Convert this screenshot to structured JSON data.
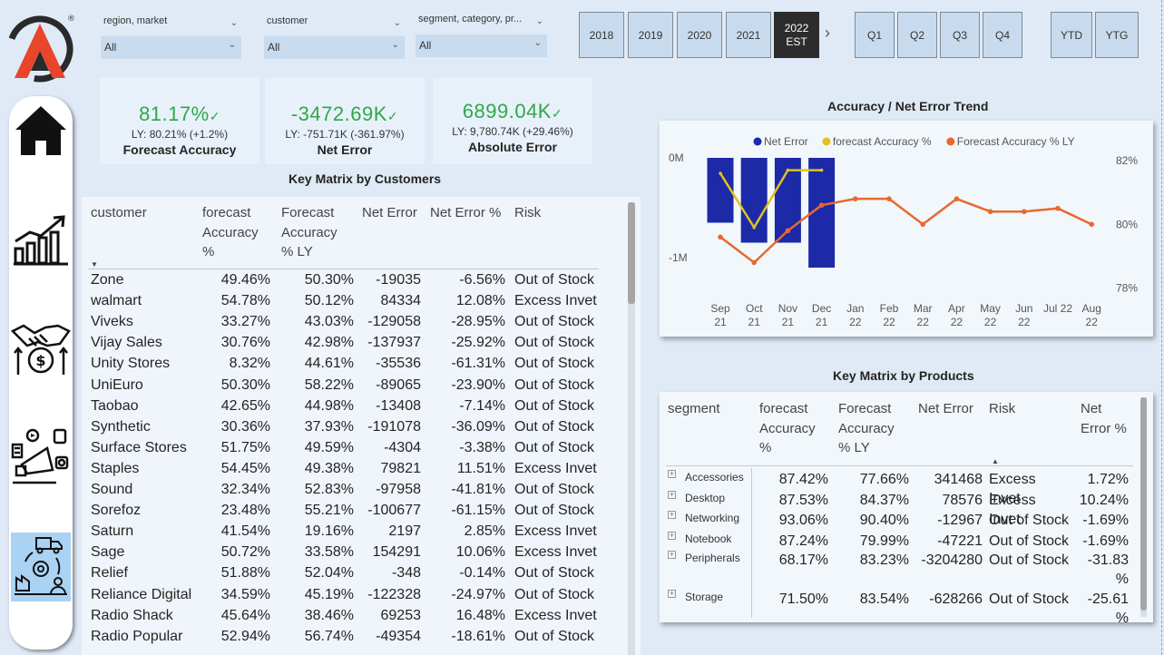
{
  "filters": [
    {
      "title": "region, market",
      "value": "All"
    },
    {
      "title": "customer",
      "value": "All"
    },
    {
      "title": "segment, category, pr...",
      "value": "All"
    }
  ],
  "years": [
    {
      "label": "2018",
      "active": false
    },
    {
      "label": "2019",
      "active": false
    },
    {
      "label": "2020",
      "active": false
    },
    {
      "label": "2021",
      "active": false
    },
    {
      "label": "2022\nEST",
      "active": true
    }
  ],
  "quarters": [
    "Q1",
    "Q2",
    "Q3",
    "Q4"
  ],
  "periods": [
    "YTD",
    "YTG"
  ],
  "kpis": [
    {
      "value": "81.17%",
      "ly": "LY: 80.21% (+1.2%)",
      "label": "Forecast Accuracy"
    },
    {
      "value": "-3472.69K",
      "ly": "LY: -751.71K (-361.97%)",
      "label": "Net Error"
    },
    {
      "value": "6899.04K",
      "ly": "LY: 9,780.74K (+29.46%)",
      "label": "Absolute Error"
    }
  ],
  "customers_table": {
    "title": "Key Matrix by Customers",
    "headers": [
      "customer",
      "forecast\nAccuracy\n%",
      "Forecast\nAccuracy\n% LY",
      "Net Error",
      "Net Error %",
      "Risk"
    ],
    "rows": [
      [
        "Zone",
        "49.46%",
        "50.30%",
        "-19035",
        "-6.56%",
        "Out of Stock"
      ],
      [
        "walmart",
        "54.78%",
        "50.12%",
        "84334",
        "12.08%",
        "Excess Invet"
      ],
      [
        "Viveks",
        "33.27%",
        "43.03%",
        "-129058",
        "-28.95%",
        "Out of Stock"
      ],
      [
        "Vijay Sales",
        "30.76%",
        "42.98%",
        "-137937",
        "-25.92%",
        "Out of Stock"
      ],
      [
        "Unity Stores",
        "8.32%",
        "44.61%",
        "-35536",
        "-61.31%",
        "Out of Stock"
      ],
      [
        "UniEuro",
        "50.30%",
        "58.22%",
        "-89065",
        "-23.90%",
        "Out of Stock"
      ],
      [
        "Taobao",
        "42.65%",
        "44.98%",
        "-13408",
        "-7.14%",
        "Out of Stock"
      ],
      [
        "Synthetic",
        "30.36%",
        "37.93%",
        "-191078",
        "-36.09%",
        "Out of Stock"
      ],
      [
        "Surface Stores",
        "51.75%",
        "49.59%",
        "-4304",
        "-3.38%",
        "Out of Stock"
      ],
      [
        "Staples",
        "54.45%",
        "49.38%",
        "79821",
        "11.51%",
        "Excess Invet"
      ],
      [
        "Sound",
        "32.34%",
        "52.83%",
        "-97958",
        "-41.81%",
        "Out of Stock"
      ],
      [
        "Sorefoz",
        "23.48%",
        "55.21%",
        "-100677",
        "-61.15%",
        "Out of Stock"
      ],
      [
        "Saturn",
        "41.54%",
        "19.16%",
        "2197",
        "2.85%",
        "Excess Invet"
      ],
      [
        "Sage",
        "50.72%",
        "33.58%",
        "154291",
        "10.06%",
        "Excess Invet"
      ],
      [
        "Relief",
        "51.88%",
        "52.04%",
        "-348",
        "-0.14%",
        "Out of Stock"
      ],
      [
        "Reliance Digital",
        "34.59%",
        "45.19%",
        "-122328",
        "-24.97%",
        "Out of Stock"
      ],
      [
        "Radio Shack",
        "45.64%",
        "38.46%",
        "69253",
        "16.48%",
        "Excess Invet"
      ],
      [
        "Radio Popular",
        "52.94%",
        "56.74%",
        "-49354",
        "-18.61%",
        "Out of Stock"
      ]
    ]
  },
  "products_table": {
    "title": "Key Matrix by Products",
    "headers": [
      "segment",
      "forecast\nAccuracy\n%",
      "Forecast\nAccuracy\n% LY",
      "Net Error",
      "Risk",
      "Net\nError %"
    ],
    "rows": [
      [
        "Accessories",
        "87.42%",
        "77.66%",
        "341468",
        "Excess Invet",
        "1.72%"
      ],
      [
        "Desktop",
        "87.53%",
        "84.37%",
        "78576",
        "Excess Invet",
        "10.24%"
      ],
      [
        "Networking",
        "93.06%",
        "90.40%",
        "-12967",
        "Out of Stock",
        "-1.69%"
      ],
      [
        "Notebook",
        "87.24%",
        "79.99%",
        "-47221",
        "Out of Stock",
        "-1.69%"
      ],
      [
        "Peripherals",
        "68.17%",
        "83.23%",
        "-3204280",
        "Out of Stock",
        "-31.83\n%"
      ],
      [
        "Storage",
        "71.50%",
        "83.54%",
        "-628266",
        "Out of Stock",
        "-25.61\n%"
      ]
    ]
  },
  "chart_data": {
    "type": "line",
    "title": "Accuracy / Net Error Trend",
    "categories": [
      "Sep\n21",
      "Oct\n21",
      "Nov\n21",
      "Dec\n21",
      "Jan\n22",
      "Feb\n22",
      "Mar\n22",
      "Apr\n22",
      "May\n22",
      "Jun\n22",
      "Jul 22",
      "Aug\n22"
    ],
    "left_axis": {
      "ticks": [
        "0M",
        "-1M"
      ],
      "ylim": [
        -1.4,
        0.1
      ]
    },
    "right_axis": {
      "ticks": [
        "82%",
        "80%",
        "78%"
      ],
      "ylim": [
        77.7,
        82.4
      ]
    },
    "series": [
      {
        "name": "Net Error",
        "type": "bar",
        "color": "#1c2aa8",
        "axis": "left",
        "values": [
          -0.65,
          -0.85,
          -0.85,
          -1.1,
          null,
          null,
          null,
          null,
          null,
          null,
          null,
          null
        ]
      },
      {
        "name": "forecast Accuracy %",
        "type": "line",
        "color": "#e0c21c",
        "axis": "right",
        "values": [
          81.6,
          79.9,
          81.7,
          81.7,
          null,
          null,
          null,
          null,
          null,
          null,
          null,
          null
        ]
      },
      {
        "name": "Forecast Accuracy % LY",
        "type": "line",
        "color": "#e8682f",
        "axis": "right",
        "values": [
          79.6,
          78.8,
          79.8,
          80.6,
          80.8,
          80.8,
          80.0,
          80.8,
          80.4,
          80.4,
          80.5,
          80.0
        ]
      }
    ],
    "legend": "top"
  }
}
